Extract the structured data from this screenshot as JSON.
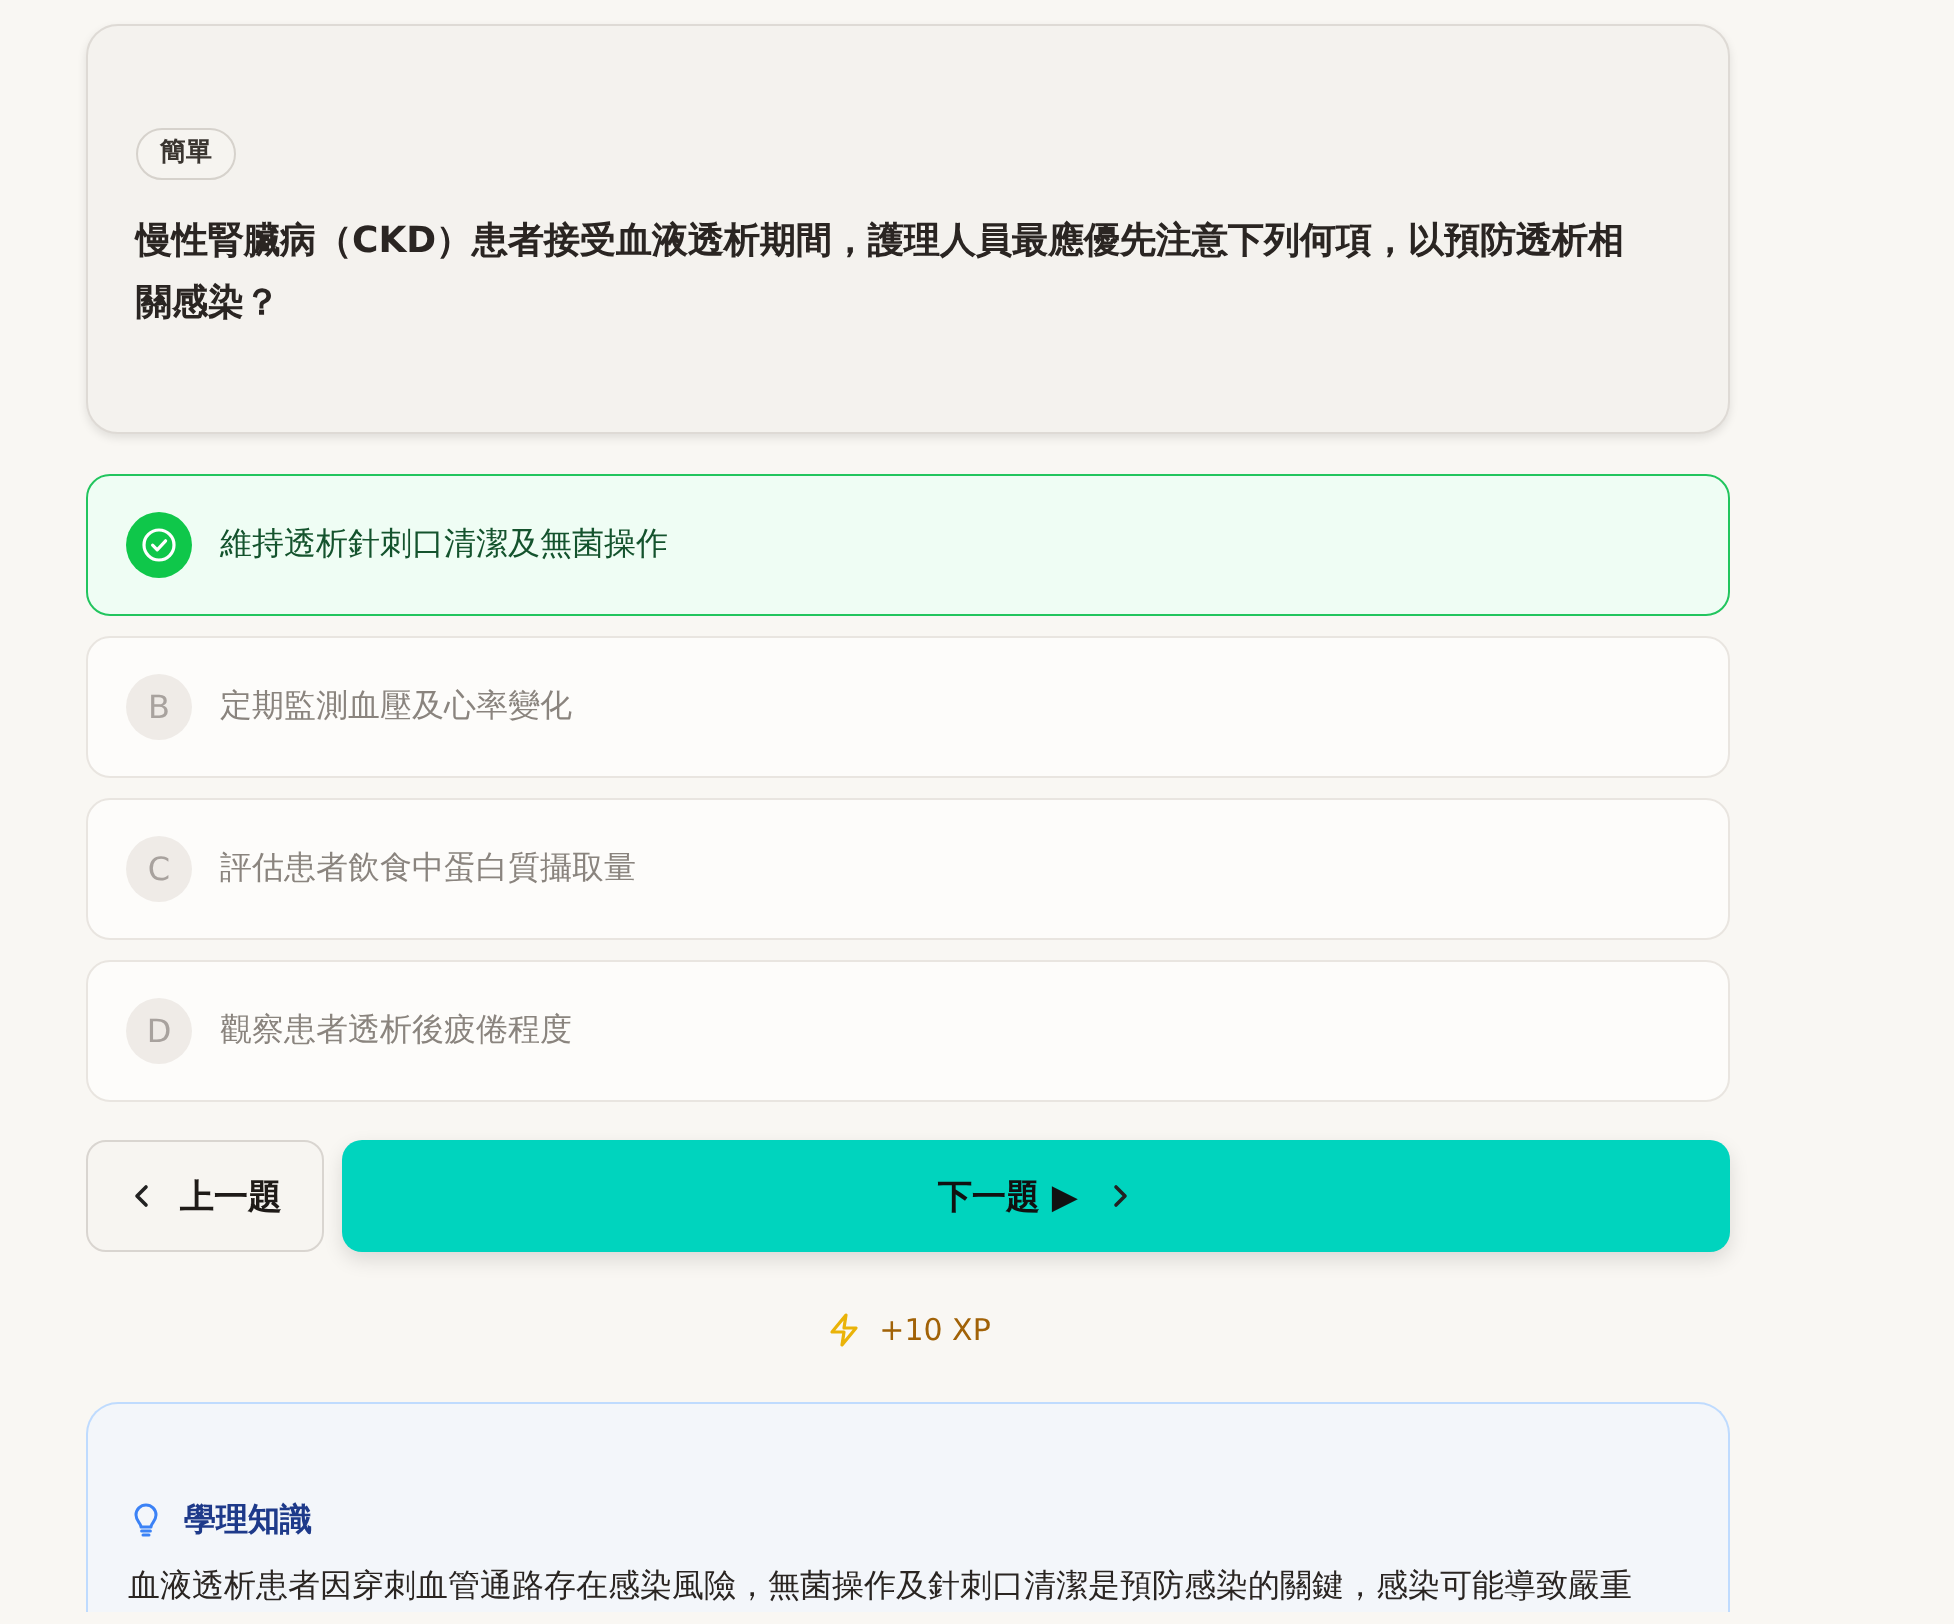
{
  "question": {
    "difficulty": "簡單",
    "text": "慢性腎臟病（CKD）患者接受血液透析期間，護理人員最應優先注意下列何項，以預防透析相關感染？"
  },
  "options": [
    {
      "text": "維持透析針刺口清潔及無菌操作",
      "selected": true
    },
    {
      "letter": "B",
      "text": "定期監測血壓及心率變化",
      "selected": false
    },
    {
      "letter": "C",
      "text": "評估患者飲食中蛋白質攝取量",
      "selected": false
    },
    {
      "letter": "D",
      "text": "觀察患者透析後疲倦程度",
      "selected": false
    }
  ],
  "navigation": {
    "previous": "上一題",
    "next": "下一題 ▶"
  },
  "reward": {
    "text": "+10 XP"
  },
  "knowledge": {
    "title": "學理知識",
    "text": "血液透析患者因穿刺血管通路存在感染風險，無菌操作及針刺口清潔是預防感染的關鍵，感染可能導致嚴重"
  }
}
